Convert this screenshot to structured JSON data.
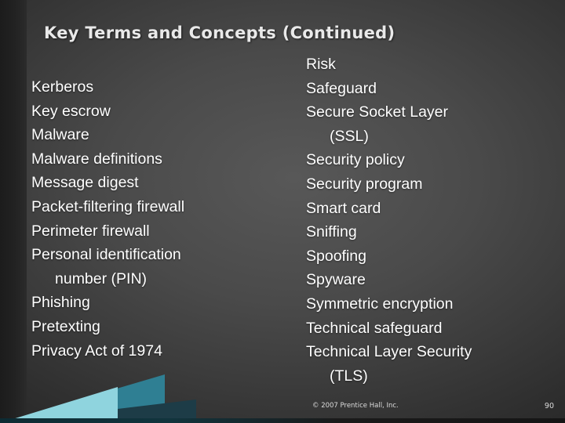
{
  "slide": {
    "title": "Key Terms and Concepts (Continued)",
    "copyright": "© 2007 Prentice Hall, Inc.",
    "page_number": "90",
    "background_color": "#4a4a4a",
    "accent_colors": {
      "teal": "#2f7f93",
      "light_teal": "#8fd4de",
      "dark_teal": "#1d3c47"
    }
  },
  "columns": {
    "left": [
      {
        "text": "Kerberos",
        "continuation": ""
      },
      {
        "text": "Key escrow",
        "continuation": ""
      },
      {
        "text": "Malware",
        "continuation": ""
      },
      {
        "text": "Malware definitions",
        "continuation": ""
      },
      {
        "text": "Message digest",
        "continuation": ""
      },
      {
        "text": "Packet-filtering firewall",
        "continuation": ""
      },
      {
        "text": "Perimeter firewall",
        "continuation": ""
      },
      {
        "text": "Personal identification",
        "continuation": "number (PIN)"
      },
      {
        "text": "Phishing",
        "continuation": ""
      },
      {
        "text": "Pretexting",
        "continuation": ""
      },
      {
        "text": "Privacy Act of 1974",
        "continuation": ""
      }
    ],
    "right": [
      {
        "text": "Risk",
        "continuation": ""
      },
      {
        "text": "Safeguard",
        "continuation": ""
      },
      {
        "text": "Secure Socket Layer",
        "continuation": "(SSL)"
      },
      {
        "text": "Security policy",
        "continuation": ""
      },
      {
        "text": "Security program",
        "continuation": ""
      },
      {
        "text": "Smart card",
        "continuation": ""
      },
      {
        "text": "Sniffing",
        "continuation": ""
      },
      {
        "text": "Spoofing",
        "continuation": ""
      },
      {
        "text": "Spyware",
        "continuation": ""
      },
      {
        "text": "Symmetric encryption",
        "continuation": ""
      },
      {
        "text": "Technical safeguard",
        "continuation": ""
      },
      {
        "text": "Technical Layer Security",
        "continuation": "(TLS)"
      }
    ]
  }
}
